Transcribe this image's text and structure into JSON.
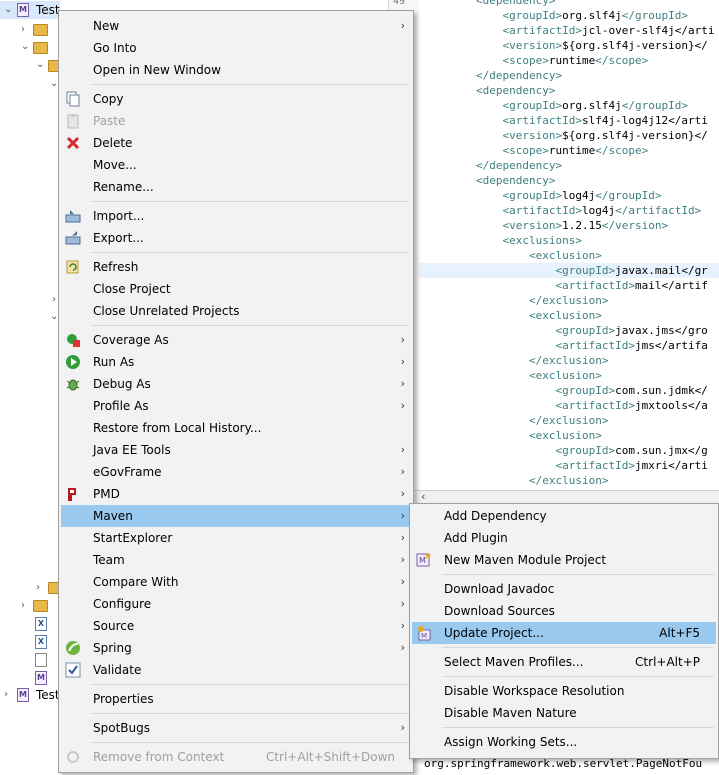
{
  "explorer": {
    "rows": [
      {
        "label": "Test"
      },
      {
        "label": "Test"
      }
    ]
  },
  "editor": {
    "line_number": "49",
    "lines": [
      "<dependency>",
      "    <groupId>org.slf4j</groupId>",
      "    <artifactId>jcl-over-slf4j</arti",
      "    <version>${org.slf4j-version}</",
      "    <scope>runtime</scope>",
      "</dependency>",
      "<dependency>",
      "    <groupId>org.slf4j</groupId>",
      "    <artifactId>slf4j-log4j12</arti",
      "    <version>${org.slf4j-version}</",
      "    <scope>runtime</scope>",
      "</dependency>",
      "<dependency>",
      "    <groupId>log4j</groupId>",
      "    <artifactId>log4j</artifactId>",
      "    <version>1.2.15</version>",
      "    <exclusions>",
      "        <exclusion>",
      "            <groupId>javax.mail</gr",
      "            <artifactId>mail</artif",
      "        </exclusion>",
      "        <exclusion>",
      "            <groupId>javax.jms</gro",
      "            <artifactId>jms</artifa",
      "        </exclusion>",
      "        <exclusion>",
      "            <groupId>com.sun.jdmk</",
      "            <artifactId>jmxtools</a",
      "        </exclusion>",
      "        <exclusion>",
      "            <groupId>com.sun.jmx</g",
      "            <artifactId>jmxri</arti",
      "        </exclusion>"
    ]
  },
  "console": {
    "text": "org.springframework.web.servlet.PageNotFou"
  },
  "context_menu": {
    "items": [
      {
        "label": "New",
        "submenu": true
      },
      {
        "label": "Go Into"
      },
      {
        "label": "Open in New Window"
      },
      {
        "label": "Copy",
        "icon": "copy-icon"
      },
      {
        "label": "Paste",
        "icon": "paste-icon",
        "disabled": true
      },
      {
        "label": "Delete",
        "icon": "delete-icon"
      },
      {
        "label": "Move..."
      },
      {
        "label": "Rename..."
      },
      {
        "label": "Import...",
        "icon": "import-icon"
      },
      {
        "label": "Export...",
        "icon": "export-icon"
      },
      {
        "label": "Refresh",
        "icon": "refresh-icon"
      },
      {
        "label": "Close Project"
      },
      {
        "label": "Close Unrelated Projects"
      },
      {
        "label": "Coverage As",
        "icon": "coverage-icon",
        "submenu": true
      },
      {
        "label": "Run As",
        "icon": "run-icon",
        "submenu": true
      },
      {
        "label": "Debug As",
        "icon": "debug-icon",
        "submenu": true
      },
      {
        "label": "Profile As",
        "submenu": true
      },
      {
        "label": "Restore from Local History..."
      },
      {
        "label": "Java EE Tools",
        "submenu": true
      },
      {
        "label": "eGovFrame",
        "submenu": true
      },
      {
        "label": "PMD",
        "icon": "pmd-icon",
        "submenu": true
      },
      {
        "label": "Maven",
        "submenu": true,
        "highlighted": true
      },
      {
        "label": "StartExplorer",
        "submenu": true
      },
      {
        "label": "Team",
        "submenu": true
      },
      {
        "label": "Compare With",
        "submenu": true
      },
      {
        "label": "Configure",
        "submenu": true
      },
      {
        "label": "Source",
        "submenu": true
      },
      {
        "label": "Spring",
        "icon": "spring-icon",
        "submenu": true
      },
      {
        "label": "Validate",
        "icon": "validate-icon"
      },
      {
        "label": "Properties"
      },
      {
        "label": "SpotBugs",
        "submenu": true
      },
      {
        "label": "Remove from Context",
        "shortcut": "Ctrl+Alt+Shift+Down",
        "disabled": true,
        "icon": "remove-context-icon"
      }
    ]
  },
  "maven_menu": {
    "items": [
      {
        "label": "Add Dependency"
      },
      {
        "label": "Add Plugin"
      },
      {
        "label": "New Maven Module Project",
        "icon": "maven-module-icon"
      },
      {
        "label": "Download Javadoc"
      },
      {
        "label": "Download Sources"
      },
      {
        "label": "Update Project...",
        "shortcut": "Alt+F5",
        "icon": "update-project-icon",
        "highlighted": true
      },
      {
        "label": "Select Maven Profiles...",
        "shortcut": "Ctrl+Alt+P"
      },
      {
        "label": "Disable Workspace Resolution"
      },
      {
        "label": "Disable Maven Nature"
      },
      {
        "label": "Assign Working Sets..."
      }
    ]
  },
  "colors": {
    "menu_bg": "#f2f2f2",
    "highlight": "#99c9ef",
    "xml_tag": "#3f7f7f",
    "disabled_text": "#a0a0a0"
  }
}
